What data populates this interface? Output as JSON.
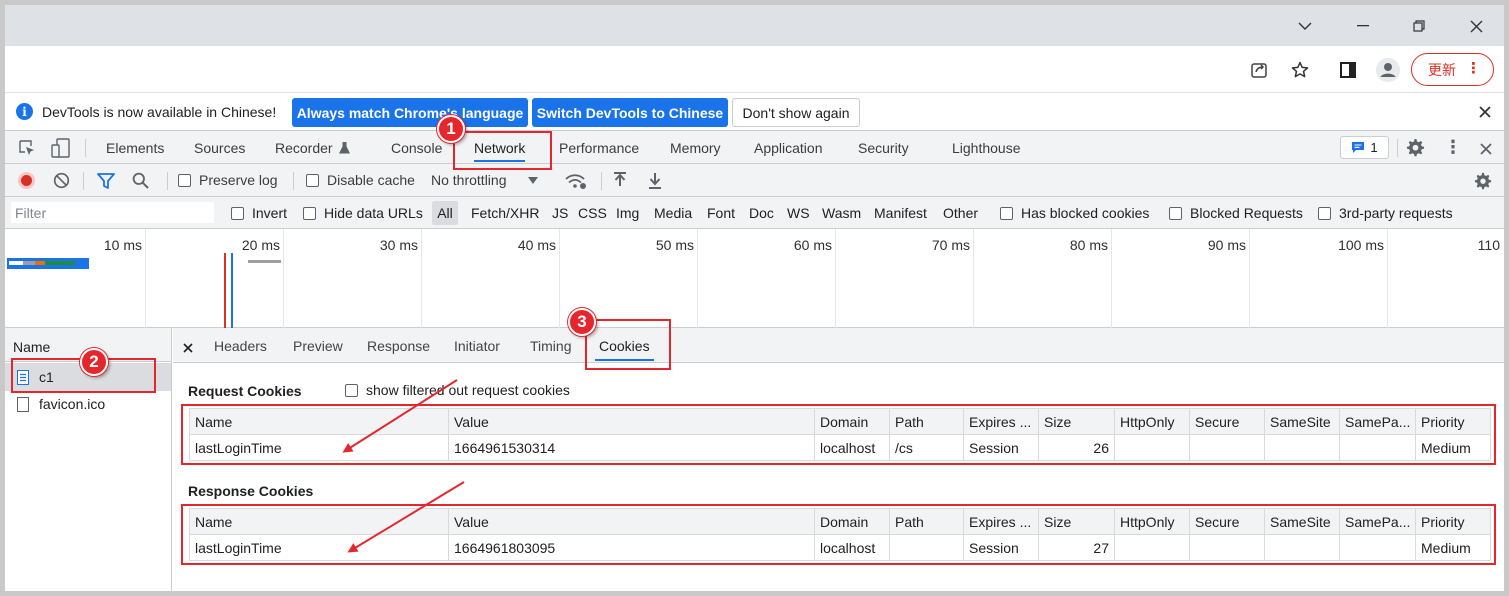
{
  "window_controls": {
    "dropdown_icon": "chevron-down-icon",
    "minimize_icon": "minimize-icon",
    "restore_icon": "restore-icon",
    "close_icon": "close-icon"
  },
  "browser_toolbar": {
    "update_label": "更新"
  },
  "infobar": {
    "message": "DevTools is now available in Chinese!",
    "match_button": "Always match Chrome's language",
    "switch_button": "Switch DevTools to Chinese",
    "dismiss_button": "Don't show again"
  },
  "devtools_tabs": [
    "Elements",
    "Sources",
    "Recorder",
    "Console",
    "Network",
    "Performance",
    "Memory",
    "Application",
    "Security",
    "Lighthouse"
  ],
  "issues_count": "1",
  "network_toolbar": {
    "preserve_log": "Preserve log",
    "disable_cache": "Disable cache",
    "throttling": "No throttling"
  },
  "filter_bar": {
    "placeholder": "Filter",
    "invert": "Invert",
    "hide_data_urls": "Hide data URLs",
    "types": [
      "All",
      "Fetch/XHR",
      "JS",
      "CSS",
      "Img",
      "Media",
      "Font",
      "Doc",
      "WS",
      "Wasm",
      "Manifest",
      "Other"
    ],
    "has_blocked_cookies": "Has blocked cookies",
    "blocked_requests": "Blocked Requests",
    "third_party": "3rd-party requests"
  },
  "timeline_ticks": [
    "10 ms",
    "20 ms",
    "30 ms",
    "40 ms",
    "50 ms",
    "60 ms",
    "70 ms",
    "80 ms",
    "90 ms",
    "100 ms",
    "110"
  ],
  "requests": {
    "header": "Name",
    "items": [
      "c1",
      "favicon.ico"
    ]
  },
  "detail_tabs": [
    "Headers",
    "Preview",
    "Response",
    "Initiator",
    "Timing",
    "Cookies"
  ],
  "cookies": {
    "request_title": "Request Cookies",
    "show_filtered": "show filtered out request cookies",
    "response_title": "Response Cookies",
    "columns": [
      "Name",
      "Value",
      "Domain",
      "Path",
      "Expires ...",
      "Size",
      "HttpOnly",
      "Secure",
      "SameSite",
      "SamePa...",
      "Priority"
    ],
    "request_rows": [
      [
        "lastLoginTime",
        "1664961530314",
        "localhost",
        "/cs",
        "Session",
        "26",
        "",
        "",
        "",
        "",
        "Medium"
      ]
    ],
    "response_rows": [
      [
        "lastLoginTime",
        "1664961803095",
        "localhost",
        "",
        "Session",
        "27",
        "",
        "",
        "",
        "",
        "Medium"
      ]
    ]
  },
  "annotations": {
    "badge_1": "1",
    "badge_2": "2",
    "badge_3": "3"
  }
}
